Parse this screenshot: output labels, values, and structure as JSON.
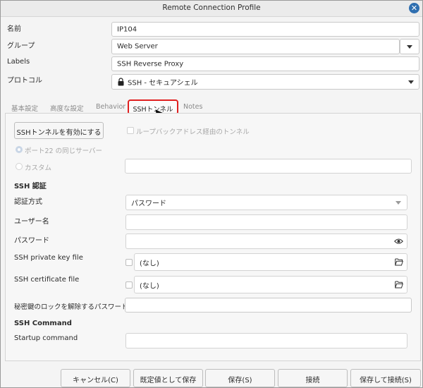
{
  "window": {
    "title": "Remote Connection Profile"
  },
  "form": {
    "name_label": "名前",
    "name_value": "IP104",
    "group_label": "グループ",
    "group_value": "Web Server",
    "labels_label": "Labels",
    "labels_value": "SSH Reverse Proxy",
    "protocol_label": "プロトコル",
    "protocol_value": "SSH - セキュアシェル"
  },
  "tabs": [
    "基本設定",
    "高度な設定",
    "Behavior",
    "SSHトンネル",
    "Notes"
  ],
  "active_tab": "SSHトンネル",
  "tunnel": {
    "enable_button": "SSHトンネルを有効にする",
    "loopback_label": "ループバックアドレス経由のトンネル",
    "same_server_label": "ポート22 の同じサーバー",
    "custom_label": "カスタム",
    "custom_value": ""
  },
  "auth": {
    "section_title": "SSH 認証",
    "method_label": "認証方式",
    "method_value": "パスワード",
    "user_label": "ユーザー名",
    "user_value": "",
    "password_label": "パスワード",
    "password_value": "",
    "private_key_label": "SSH private key file",
    "private_key_value": "(なし)",
    "certificate_label": "SSH certificate file",
    "certificate_value": "(なし)",
    "passphrase_label": "秘密鍵のロックを解除するパスワード",
    "passphrase_value": ""
  },
  "command": {
    "section_title": "SSH Command",
    "startup_label": "Startup command",
    "startup_value": ""
  },
  "footer": {
    "cancel": "キャンセル(C)",
    "save_default": "既定値として保存",
    "save": "保存(S)",
    "connect": "接続",
    "save_connect": "保存して接続(S)"
  },
  "colors": {
    "accent": "#2f6fb0",
    "highlight": "#e02020"
  }
}
